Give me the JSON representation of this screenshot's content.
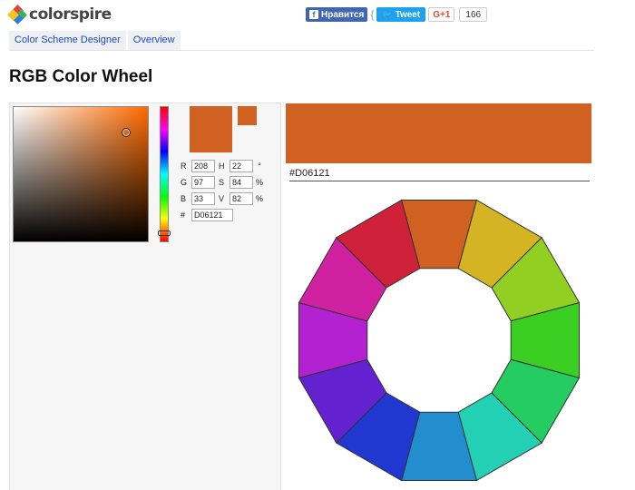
{
  "header": {
    "logo_text": "colorspire",
    "facebook_label": "Нравится",
    "tweet_label": "Tweet",
    "gplus_label": "G+1",
    "share_count": "166"
  },
  "nav": {
    "tabs": [
      {
        "label": "Color Scheme Designer"
      },
      {
        "label": "Overview"
      }
    ]
  },
  "page": {
    "title": "RGB Color Wheel"
  },
  "picker": {
    "fields": {
      "r": {
        "label": "R",
        "value": "208"
      },
      "g": {
        "label": "G",
        "value": "97"
      },
      "b": {
        "label": "B",
        "value": "33"
      },
      "h": {
        "label": "H",
        "value": "22",
        "unit": "°"
      },
      "s": {
        "label": "S",
        "value": "84",
        "unit": "%"
      },
      "v": {
        "label": "V",
        "value": "82",
        "unit": "%"
      },
      "hex": {
        "label": "#",
        "value": "D06121"
      }
    }
  },
  "selected": {
    "hex_display": "#D06121",
    "color": "#D06121"
  },
  "colors": {
    "swatch_old": "#D06121",
    "wheel_segments": [
      "#D06121",
      "#D4B422",
      "#91D022",
      "#3BCF24",
      "#25CC62",
      "#24D0B4",
      "#228ED0",
      "#2138D0",
      "#6421CF",
      "#B421D0",
      "#D021A0",
      "#CF2139"
    ],
    "wheel_stroke": "#333333"
  }
}
